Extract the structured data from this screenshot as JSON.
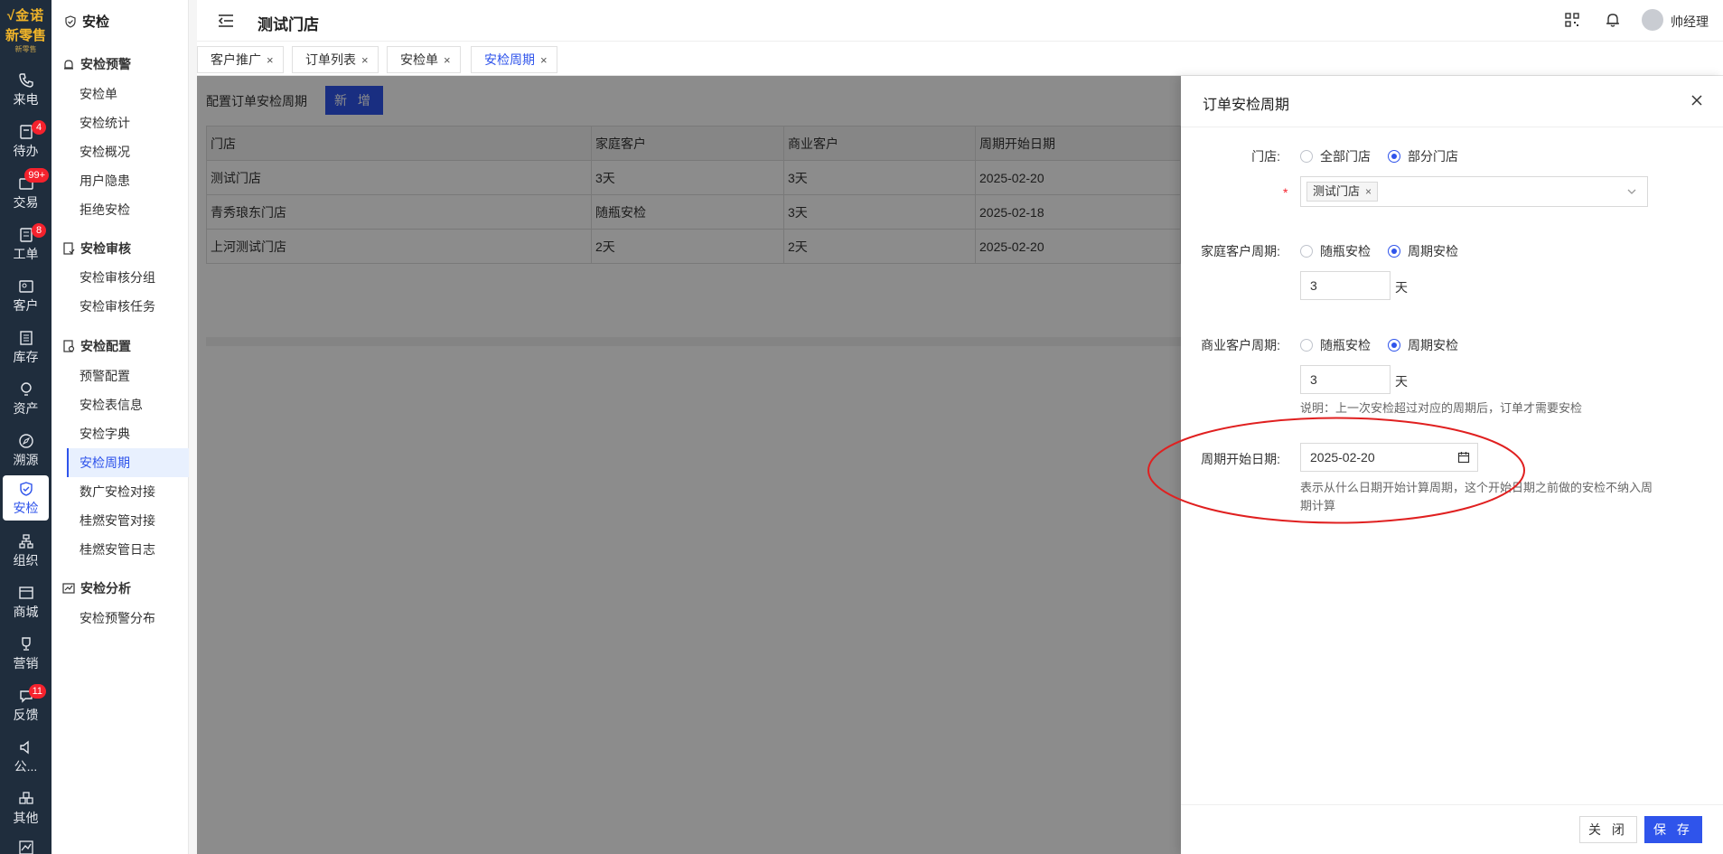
{
  "logo": {
    "top": "√金诺",
    "mid": "新零售",
    "sub": "新零售"
  },
  "rail": [
    {
      "label": "来电",
      "icon": "phone-icon"
    },
    {
      "label": "待办",
      "icon": "todo-icon",
      "badge": "4"
    },
    {
      "label": "交易",
      "icon": "trade-icon",
      "badge": "99+"
    },
    {
      "label": "工单",
      "icon": "workorder-icon",
      "badge": "8"
    },
    {
      "label": "客户",
      "icon": "customer-icon"
    },
    {
      "label": "库存",
      "icon": "inventory-icon"
    },
    {
      "label": "资产",
      "icon": "asset-icon"
    },
    {
      "label": "溯源",
      "icon": "trace-icon"
    },
    {
      "label": "安检",
      "icon": "shield-icon"
    },
    {
      "label": "组织",
      "icon": "org-icon"
    },
    {
      "label": "商城",
      "icon": "mall-icon"
    },
    {
      "label": "营销",
      "icon": "trophy-icon"
    },
    {
      "label": "反馈",
      "icon": "feedback-icon",
      "badge": "11"
    },
    {
      "label": "公...",
      "icon": "announce-icon"
    },
    {
      "label": "其他",
      "icon": "other-icon"
    }
  ],
  "submenu": {
    "title": "安检",
    "groups": [
      {
        "label": "安检预警",
        "items": [
          "安检单",
          "安检统计",
          "安检概况",
          "用户隐患",
          "拒绝安检"
        ]
      },
      {
        "label": "安检审核",
        "items": [
          "安检审核分组",
          "安检审核任务"
        ]
      },
      {
        "label": "安检配置",
        "items": [
          "预警配置",
          "安检表信息",
          "安检字典",
          "安检周期",
          "数广安检对接",
          "桂燃安管对接",
          "桂燃安管日志"
        ]
      },
      {
        "label": "安检分析",
        "items": [
          "安检预警分布"
        ]
      }
    ]
  },
  "header": {
    "title": "测试门店",
    "username": "帅经理"
  },
  "tabs": [
    {
      "label": "客户推广"
    },
    {
      "label": "订单列表"
    },
    {
      "label": "安检单"
    },
    {
      "label": "安检周期"
    }
  ],
  "tab_close": "×",
  "main": {
    "toolbar_label": "配置订单安检周期",
    "add_button": "新 增",
    "columns": [
      "门店",
      "家庭客户",
      "商业客户",
      "周期开始日期"
    ],
    "rows": [
      [
        "测试门店",
        "3天",
        "3天",
        "2025-02-20"
      ],
      [
        "青秀琅东门店",
        "随瓶安检",
        "3天",
        "2025-02-18"
      ],
      [
        "上河测试门店",
        "2天",
        "2天",
        "2025-02-20"
      ]
    ]
  },
  "drawer": {
    "title": "订单安检周期",
    "store_label": "门店:",
    "store_options": [
      "全部门店",
      "部分门店"
    ],
    "required_mark": "*",
    "selected_store": "测试门店",
    "chip_close": "×",
    "home_label": "家庭客户周期:",
    "home_options": [
      "随瓶安检",
      "周期安检"
    ],
    "home_days": "3",
    "biz_label": "商业客户周期:",
    "biz_options": [
      "随瓶安检",
      "周期安检"
    ],
    "biz_days": "3",
    "unit": "天",
    "note": "说明：上一次安检超过对应的周期后，订单才需要安检",
    "date_label": "周期开始日期:",
    "date_value": "2025-02-20",
    "date_hint": "表示从什么日期开始计算周期，这个开始日期之前做的安检不纳入周期计算",
    "close_button": "关 闭",
    "save_button": "保 存"
  },
  "colors": {
    "accent": "#2f54eb",
    "rail_bg": "#1f2d3d",
    "annotation": "#e02020"
  }
}
